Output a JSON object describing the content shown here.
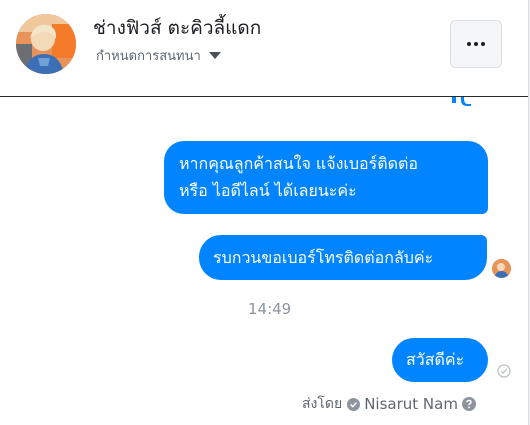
{
  "header": {
    "title": "ช่างฟิวส์ ตะคิวลี้แดก",
    "subtitle": "กำหนดการสนทนา",
    "avatar_icon": "profile-photo",
    "more_icon": "more-dots-icon"
  },
  "messages": [
    {
      "lines": [
        "หากคุณลูกค้าสนใจ แจ้งเบอร์ติดต่อ",
        "หรือ ไอดีไลน์ ได้เลยนะค่ะ"
      ]
    },
    {
      "text": "รบกวนขอเบอร์โทรติดต่อกลับค่ะ"
    },
    {
      "text": "สวัสดีค่ะ"
    }
  ],
  "timestamp": "14:49",
  "footer": {
    "sent_by_label": "ส่งโดย",
    "sender_name": "Nisarut Nam"
  },
  "colors": {
    "bubble": "#0084ff",
    "bubble_text": "#ffffff",
    "muted_text": "#8d949e"
  }
}
